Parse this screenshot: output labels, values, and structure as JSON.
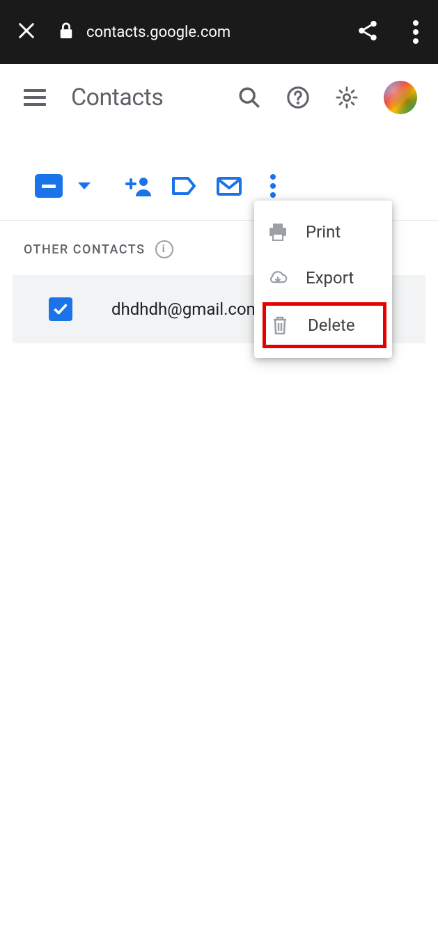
{
  "browser": {
    "url": "contacts.google.com"
  },
  "app": {
    "title": "Contacts"
  },
  "section": {
    "header": "OTHER CONTACTS"
  },
  "contact": {
    "email": "dhdhdh@gmail.com"
  },
  "menu": {
    "items": [
      {
        "label": "Print",
        "icon": "print"
      },
      {
        "label": "Export",
        "icon": "cloud-download"
      },
      {
        "label": "Delete",
        "icon": "trash"
      }
    ]
  }
}
